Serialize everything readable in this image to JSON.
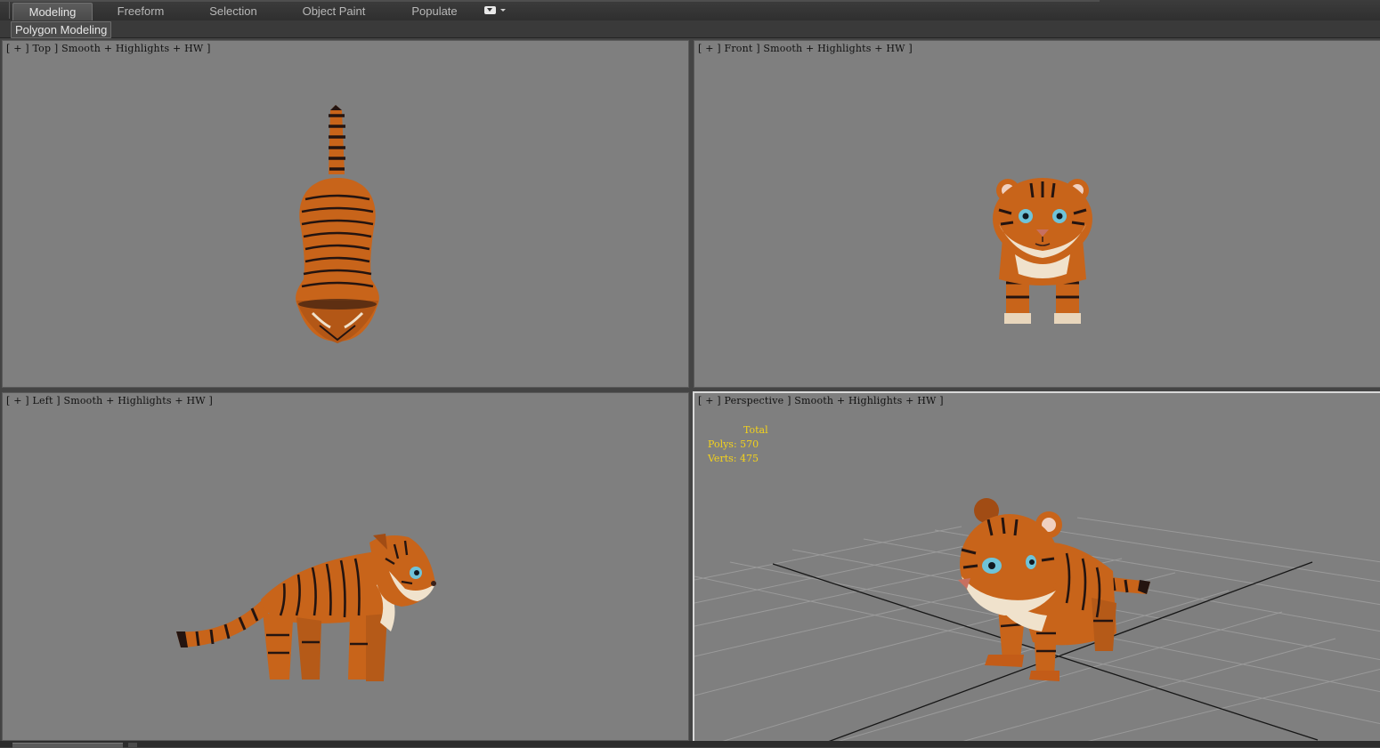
{
  "ribbon": {
    "tabs": [
      {
        "label": "Modeling",
        "active": true
      },
      {
        "label": "Freeform",
        "active": false
      },
      {
        "label": "Selection",
        "active": false
      },
      {
        "label": "Object Paint",
        "active": false
      },
      {
        "label": "Populate",
        "active": false
      }
    ],
    "panel_label": "Polygon Modeling"
  },
  "viewports": {
    "top": {
      "label": "[ + ] Top ] Smooth + Highlights + HW ]"
    },
    "front": {
      "label": "[ + ] Front ] Smooth + Highlights + HW ]"
    },
    "left": {
      "label": "[ + ] Left ] Smooth + Highlights + HW ]"
    },
    "perspective": {
      "label": "[ + ] Perspective ] Smooth + Highlights + HW ]",
      "active": true,
      "stats": {
        "heading": "Total",
        "polys_label": "Polys:",
        "polys_value": "570",
        "verts_label": "Verts:",
        "verts_value": "475"
      }
    }
  },
  "colors": {
    "viewport_bg": "#7f7f7f",
    "stats_text": "#f3d21c",
    "tiger_orange": "#c8641a",
    "tiger_stripe": "#241410",
    "tiger_fur_light": "#f0e2cc",
    "eye_blue": "#6fc3d8"
  },
  "icons": [
    "ribbon-options-icon",
    "ribbon-caret-icon"
  ]
}
